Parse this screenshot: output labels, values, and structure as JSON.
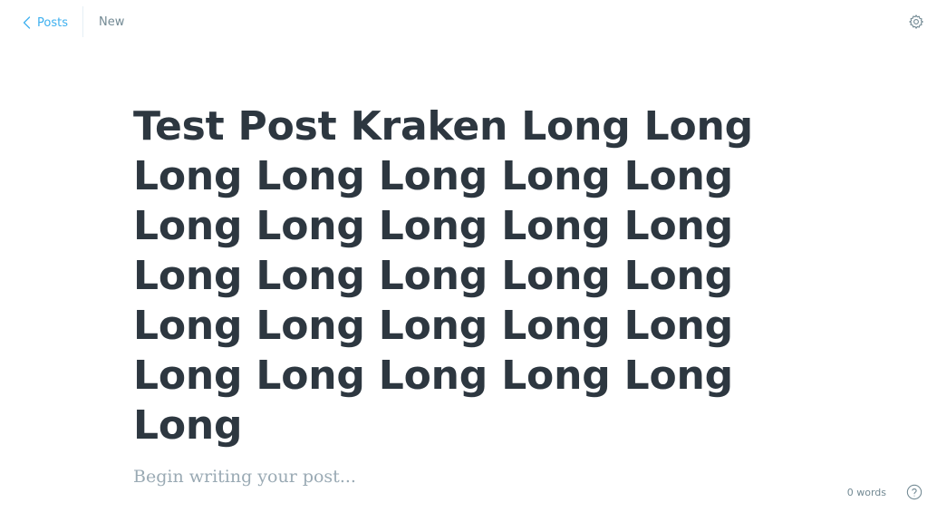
{
  "nav": {
    "back_label": "Posts",
    "status_label": "New"
  },
  "editor": {
    "title": "Test Post Kraken Long Long Long Long Long Long Long Long Long Long Long Long Long Long Long Long Long Long Long Long Long Long Long Long Long Long Long Long",
    "body_placeholder": "Begin writing your post..."
  },
  "footer": {
    "word_count": "0 words"
  },
  "icons": {
    "back": "chevron-left-icon",
    "settings": "gear-icon",
    "help": "question-circle-icon"
  },
  "colors": {
    "accent": "#3eb0ef",
    "title": "#2d3740",
    "muted": "#738a94",
    "placeholder": "#9aaab4"
  }
}
